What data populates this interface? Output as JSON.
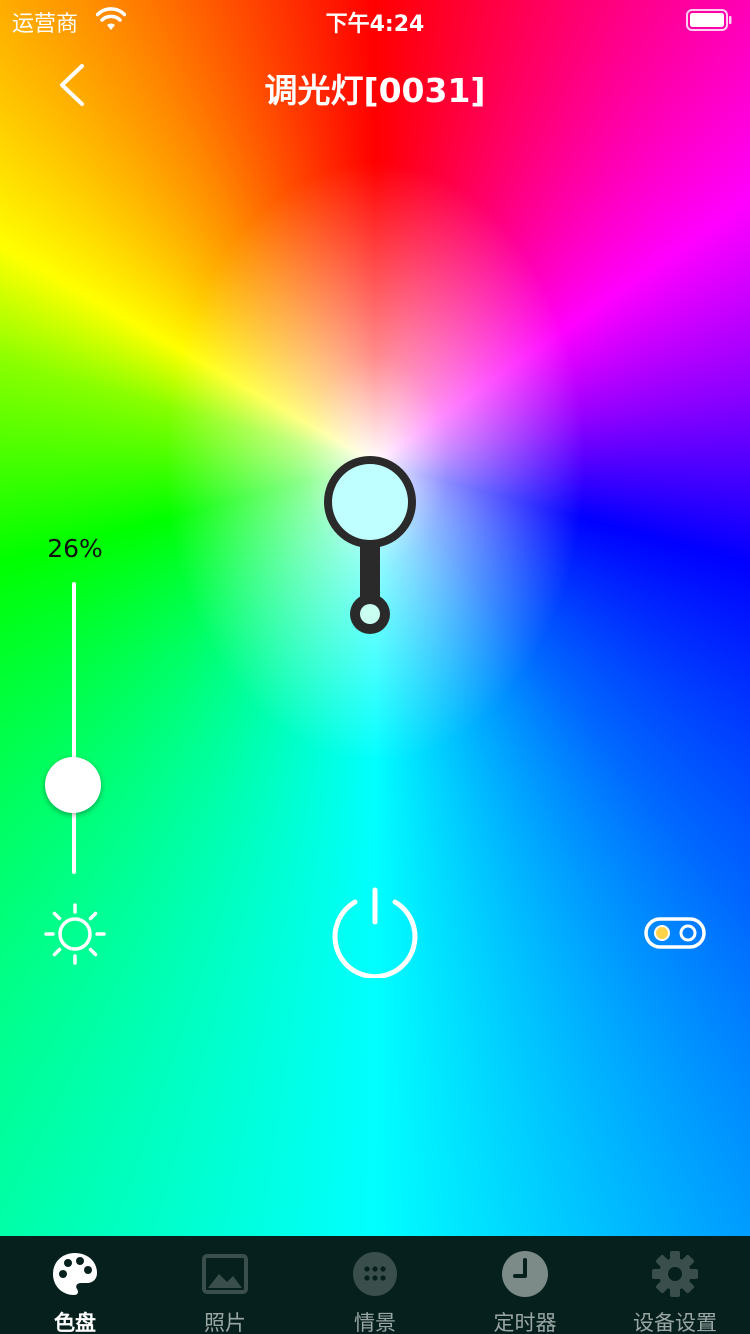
{
  "status_bar": {
    "carrier": "运营商",
    "time": "下午4:24"
  },
  "nav": {
    "title": "调光灯[0031]"
  },
  "brightness": {
    "label": "26%",
    "value": 26
  },
  "colors": {
    "picker_fill": "#c0ffff",
    "picker_ring": "#2a2a2a",
    "tab_bg": "#06211d",
    "tab_inactive": "#9aa6a4",
    "accent_yellow": "#ffd34a"
  },
  "tabs": [
    {
      "label": "色盘",
      "icon": "palette-icon",
      "active": true
    },
    {
      "label": "照片",
      "icon": "photo-icon",
      "active": false
    },
    {
      "label": "情景",
      "icon": "scenes-dots-icon",
      "active": false
    },
    {
      "label": "定时器",
      "icon": "clock-icon",
      "active": false
    },
    {
      "label": "设备设置",
      "icon": "gear-icon",
      "active": false
    }
  ]
}
